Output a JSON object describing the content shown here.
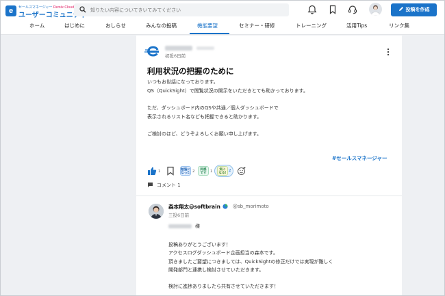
{
  "header": {
    "logo_tag": "セールスマネージャー ",
    "logo_tag_brand": "Remix Cloud",
    "logo_name": "ユーザーコミュニティ",
    "search_placeholder": "知りたい内容についてきいてみてください",
    "post_button_label": "投稿を作成"
  },
  "nav": {
    "items": [
      "ホーム",
      "はじめに",
      "おしらせ",
      "みんなの投稿",
      "機能要望",
      "セミナー・研修",
      "トレーニング",
      "活用Tips",
      "リンク集"
    ],
    "active_index": 4
  },
  "post": {
    "time": "初投6日前",
    "title": "利用状況の把握のために",
    "body": [
      "いつもお世話になっております。",
      "QS（QuickSight）で閲覧状況の開示をいただきとても助かっております。",
      "",
      "ただ、ダッシュボード内のQSや共通／個人ダッシュボードで",
      "表示されるリスト名なども把握できると助かります。",
      "",
      "ご検討のほど、どうぞよろしくお願い申し上げます。"
    ],
    "tag": "#セールスマネージャー",
    "reactions": {
      "like_count": "1",
      "stamps": [
        {
          "label": "勉強に なった",
          "count": "2"
        },
        {
          "label": "同感 です",
          "count": "1"
        },
        {
          "label": "気に なる!",
          "count": "2"
        }
      ]
    },
    "comment_label": "コメント 1"
  },
  "reply": {
    "author": "森本翔太@softbrain",
    "handle": "@sb_morimoto",
    "time": "三投6日前",
    "salutation": "様",
    "body": [
      "投稿ありがとうございます！",
      "アクセスログダッシュボード企画担当の森本です。",
      "頂きましたご要望につきましては、QuickSightの修正だけでは実現が難しく",
      "開発部門と連携し検討させていただきます。",
      "",
      "検討に進捗ありましたら共有させていただきます！"
    ]
  },
  "colors": {
    "accent": "#1a73c9",
    "background": "#eef0f3"
  }
}
